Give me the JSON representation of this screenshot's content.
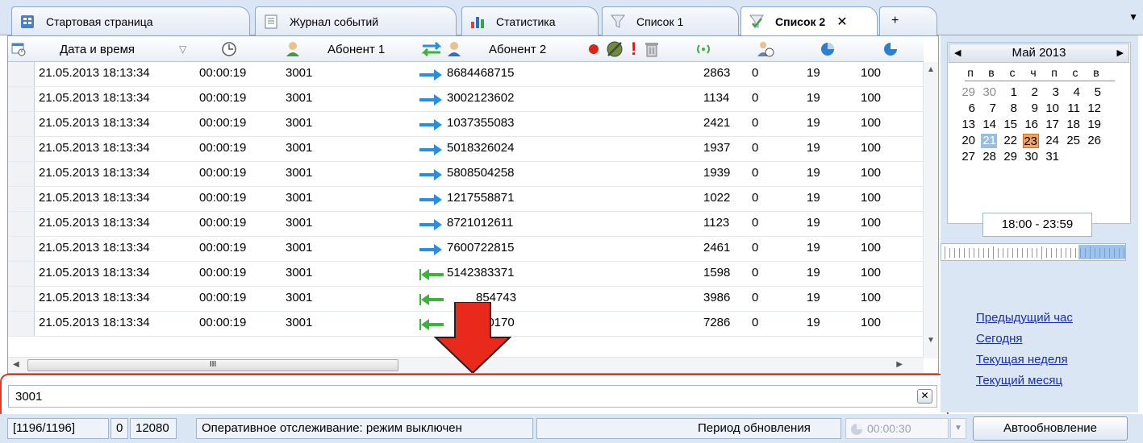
{
  "tabs": [
    {
      "label": "Стартовая страница",
      "icon": "home-grid-icon",
      "active": false
    },
    {
      "label": "Журнал событий",
      "icon": "document-icon",
      "active": false
    },
    {
      "label": "Статистика",
      "icon": "bar-chart-icon",
      "active": false
    },
    {
      "label": "Список 1",
      "icon": "filter-funnel-icon",
      "active": false
    },
    {
      "label": "Список 2",
      "icon": "filter-funnel-check-icon",
      "active": true,
      "close": "✕"
    }
  ],
  "tab_add_label": "+",
  "grid": {
    "columns": [
      "Дата и время",
      "Абонент 1",
      "Абонент 2"
    ],
    "rows": [
      {
        "datetime": "21.05.2013 18:13:34",
        "duration": "00:00:19",
        "subscriber1": "3001",
        "direction": "out",
        "subscriber2": "8684468715",
        "c1": "2863",
        "c2": "0",
        "c3": "19",
        "c4": "100"
      },
      {
        "datetime": "21.05.2013 18:13:34",
        "duration": "00:00:19",
        "subscriber1": "3001",
        "direction": "out",
        "subscriber2": "3002123602",
        "c1": "1134",
        "c2": "0",
        "c3": "19",
        "c4": "100"
      },
      {
        "datetime": "21.05.2013 18:13:34",
        "duration": "00:00:19",
        "subscriber1": "3001",
        "direction": "out",
        "subscriber2": "1037355083",
        "c1": "2421",
        "c2": "0",
        "c3": "19",
        "c4": "100"
      },
      {
        "datetime": "21.05.2013 18:13:34",
        "duration": "00:00:19",
        "subscriber1": "3001",
        "direction": "out",
        "subscriber2": "5018326024",
        "c1": "1937",
        "c2": "0",
        "c3": "19",
        "c4": "100"
      },
      {
        "datetime": "21.05.2013 18:13:34",
        "duration": "00:00:19",
        "subscriber1": "3001",
        "direction": "out",
        "subscriber2": "5808504258",
        "c1": "1939",
        "c2": "0",
        "c3": "19",
        "c4": "100"
      },
      {
        "datetime": "21.05.2013 18:13:34",
        "duration": "00:00:19",
        "subscriber1": "3001",
        "direction": "out",
        "subscriber2": "1217558871",
        "c1": "1022",
        "c2": "0",
        "c3": "19",
        "c4": "100"
      },
      {
        "datetime": "21.05.2013 18:13:34",
        "duration": "00:00:19",
        "subscriber1": "3001",
        "direction": "out",
        "subscriber2": "8721012611",
        "c1": "1123",
        "c2": "0",
        "c3": "19",
        "c4": "100"
      },
      {
        "datetime": "21.05.2013 18:13:34",
        "duration": "00:00:19",
        "subscriber1": "3001",
        "direction": "out",
        "subscriber2": "7600722815",
        "c1": "2461",
        "c2": "0",
        "c3": "19",
        "c4": "100"
      },
      {
        "datetime": "21.05.2013 18:13:34",
        "duration": "00:00:19",
        "subscriber1": "3001",
        "direction": "in",
        "subscriber2": "5142383371",
        "c1": "1598",
        "c2": "0",
        "c3": "19",
        "c4": "100"
      },
      {
        "datetime": "21.05.2013 18:13:34",
        "duration": "00:00:19",
        "subscriber1": "3001",
        "direction": "in",
        "subscriber2": "854743",
        "c1": "3986",
        "c2": "0",
        "c3": "19",
        "c4": "100"
      },
      {
        "datetime": "21.05.2013 18:13:34",
        "duration": "00:00:19",
        "subscriber1": "3001",
        "direction": "in",
        "subscriber2": "50170",
        "c1": "7286",
        "c2": "0",
        "c3": "19",
        "c4": "100"
      }
    ],
    "hscroll_thumb": "III"
  },
  "filter": {
    "value": "3001",
    "clear": "✕"
  },
  "status": {
    "counter": "[1196/1196]",
    "zero": "0",
    "total": "12080",
    "tracking": "Оперативное отслеживание: режим выключен",
    "period_label": "Период обновления",
    "period_value": "00:00:30",
    "auto_button": "Автообновление"
  },
  "calendar": {
    "title": "Май 2013",
    "weekdays": [
      "п",
      "в",
      "с",
      "ч",
      "п",
      "с",
      "в"
    ],
    "weeks": [
      [
        "29",
        "30",
        "1",
        "2",
        "3",
        "4",
        "5"
      ],
      [
        "6",
        "7",
        "8",
        "9",
        "10",
        "11",
        "12"
      ],
      [
        "13",
        "14",
        "15",
        "16",
        "17",
        "18",
        "19"
      ],
      [
        "20",
        "21",
        "22",
        "23",
        "24",
        "25",
        "26"
      ],
      [
        "27",
        "28",
        "29",
        "30",
        "31",
        "",
        ""
      ]
    ],
    "selected_day": "21",
    "today_day": "23"
  },
  "time_range": "18:00 - 23:59",
  "links": [
    "Предыдущий час",
    "Сегодня",
    "Текущая неделя",
    "Текущий месяц"
  ],
  "colors": {
    "accent": "#d93b2c",
    "selection": "#97bce6",
    "today": "#f0a566",
    "arrow_out": "#2b8de0",
    "arrow_in": "#3cb43c",
    "link": "#1a2fa8"
  }
}
